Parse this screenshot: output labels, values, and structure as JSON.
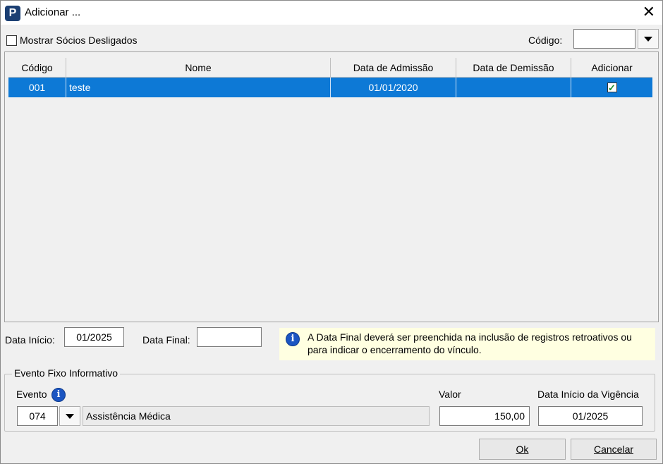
{
  "window": {
    "title": "Adicionar ..."
  },
  "filters": {
    "show_inactive_label": "Mostrar Sócios Desligados",
    "codigo_label": "Código:",
    "codigo_value": ""
  },
  "grid": {
    "columns": [
      "Código",
      "Nome",
      "Data de Admissão",
      "Data de Demissão",
      "Adicionar"
    ],
    "rows": [
      {
        "codigo": "001",
        "nome": "teste",
        "admissao": "01/01/2020",
        "demissao": "",
        "adicionar": true
      }
    ]
  },
  "dates": {
    "inicio_label": "Data Início:",
    "inicio_value": "01/2025",
    "final_label": "Data Final:",
    "final_value": ""
  },
  "info": {
    "line1": "A Data Final deverá ser preenchida na inclusão de registros retroativos ou",
    "line2": "para indicar o encerramento do vínculo."
  },
  "evento_group": {
    "title": "Evento Fixo Informativo",
    "evento_label": "Evento",
    "evento_code": "074",
    "evento_desc": "Assistência Médica",
    "valor_label": "Valor",
    "valor_value": "150,00",
    "vigencia_label": "Data Início da Vigência",
    "vigencia_value": "01/2025"
  },
  "buttons": {
    "ok": "Ok",
    "cancel": "Cancelar"
  },
  "colors": {
    "selection": "#0d79d6",
    "info_bg": "#ffffe1",
    "app_icon": "#1b3f73"
  }
}
